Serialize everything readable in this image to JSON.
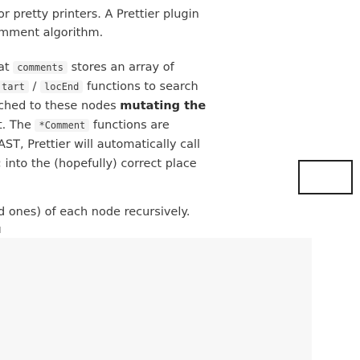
{
  "doc": {
    "line1": "or pretty printers. A Prettier plugin",
    "line2": "mment algorithm.",
    "line3": {
      "pre": "at ",
      "code": "comments",
      "post": " stores an array of"
    },
    "line4": {
      "code1": "tart",
      "sep": " / ",
      "code2": "locEnd",
      "post": " functions to search"
    },
    "line5": {
      "pre": "ched to these nodes ",
      "strong": "mutating the"
    },
    "line6": {
      "pre": "t. The ",
      "code": "*Comment",
      "post": " functions are"
    },
    "line7": "AST, Prettier will automatically call",
    "line8": "; into the (hopefully) correct place",
    "line9": "d ones) of each node recursively."
  }
}
